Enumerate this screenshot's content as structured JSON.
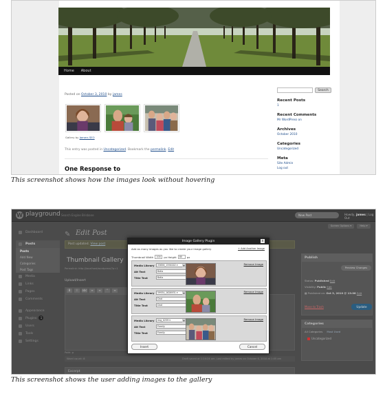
{
  "screenshot1": {
    "nav": [
      "Home",
      "About"
    ],
    "post_meta_prefix": "Posted on ",
    "post_date": "October 3, 2010",
    "post_meta_by": " by ",
    "post_author": "james",
    "gallery_by_prefix": "Gallery by ",
    "gallery_by_link": "Jamers SEO",
    "entry_line": {
      "prefix": "This entry was posted in ",
      "category": "Uncategorized",
      "middle": ". Bookmark the ",
      "permalink": "permalink",
      "dot": ". ",
      "edit": "Edit"
    },
    "responses_heading": "One Response to",
    "search_button": "Search",
    "sidebar": {
      "recent_posts": {
        "heading": "Recent Posts",
        "items": [
          "1"
        ]
      },
      "recent_comments": {
        "heading": "Recent Comments",
        "items": [
          "Mr WordPress on"
        ]
      },
      "archives": {
        "heading": "Archives",
        "items": [
          "October 2010"
        ]
      },
      "categories": {
        "heading": "Categories",
        "items": [
          "Uncategorized"
        ]
      },
      "meta": {
        "heading": "Meta",
        "items": [
          "Site Admin",
          "Log out"
        ]
      }
    }
  },
  "caption1": "This screenshot shows how the images look without hovering",
  "screenshot2": {
    "logo_glyph": "W",
    "site_title": "playground",
    "site_subtitle": "Search Engine Brisbane",
    "new_post_select": "New Post",
    "howdy_prefix": "Howdy, ",
    "howdy_user": "james",
    "howdy_suffix": " | Log Out",
    "screen_options": "Screen Options ▾",
    "help": "Help ▾",
    "menu": {
      "dashboard": "Dashboard",
      "posts": "Posts",
      "posts_sub": [
        "Posts",
        "Add New",
        "Categories",
        "Post Tags"
      ],
      "media": "Media",
      "links": "Links",
      "pages": "Pages",
      "comments": "Comments",
      "appearance": "Appearance",
      "plugins": "Plugins",
      "plugins_badge": "1",
      "users": "Users",
      "tools": "Tools",
      "settings": "Settings"
    },
    "edit_post_heading": "Edit Post",
    "updated_notice": "Post updated.",
    "view_post": "View post",
    "post_title": "Thumbnail Gallery",
    "permalink_line": "Permalink: http://localhost/wordpress/?p=1",
    "upload_insert": "Upload/Insert",
    "toolbar_buttons": [
      "B",
      "I",
      "abc",
      "≡",
      "≡",
      "“",
      "≡"
    ],
    "path": "Path: p",
    "word_count": "Word count: 8",
    "draft_saved": "Draft saved at 1:24:24 am. Last edited by james on October 6, 2010 at 1:05 am",
    "excerpt": "Excerpt",
    "publish": {
      "heading": "Publish",
      "preview": "Preview Changes",
      "status_label": "Status: ",
      "status_value": "Published",
      "visibility_label": "Visibility: ",
      "visibility_value": "Public",
      "published_on_label": "Published on: ",
      "published_on_value": "Oct 3, 2010 @ 13:08",
      "edit": "Edit",
      "trash": "Move to Trash",
      "update": "Update"
    },
    "categories": {
      "heading": "Categories",
      "tabs": [
        "All Categories",
        "Most Used"
      ],
      "items": [
        "Uncategorized"
      ]
    },
    "modal": {
      "title": "Image Gallery Plugin",
      "close": "x",
      "intro": "Add as many images as you like to create your image gallery",
      "add_another": "+ Add Another Image",
      "thumb_width_label": "Thumbnail Width",
      "thumb_width_value": "100",
      "height_label": "px Height",
      "height_value": "80",
      "px": "px",
      "media_library_label": "Media Library",
      "alt_text_label": "Alt Text",
      "title_text_label": "Title Text",
      "remove_image": "Remove Image",
      "images": [
        {
          "media": "33656_1594002 ▾",
          "alt": "Bella",
          "title": "Bella"
        },
        {
          "media": "59934_1626931 ▾",
          "alt": "Dad",
          "title": "Dad"
        },
        {
          "media": "img_0259 ▾",
          "alt": "Family",
          "title": "Family"
        }
      ],
      "insert": "Insert",
      "cancel": "Cancel"
    }
  },
  "caption2": "This screenshot shows the user adding images to the gallery"
}
